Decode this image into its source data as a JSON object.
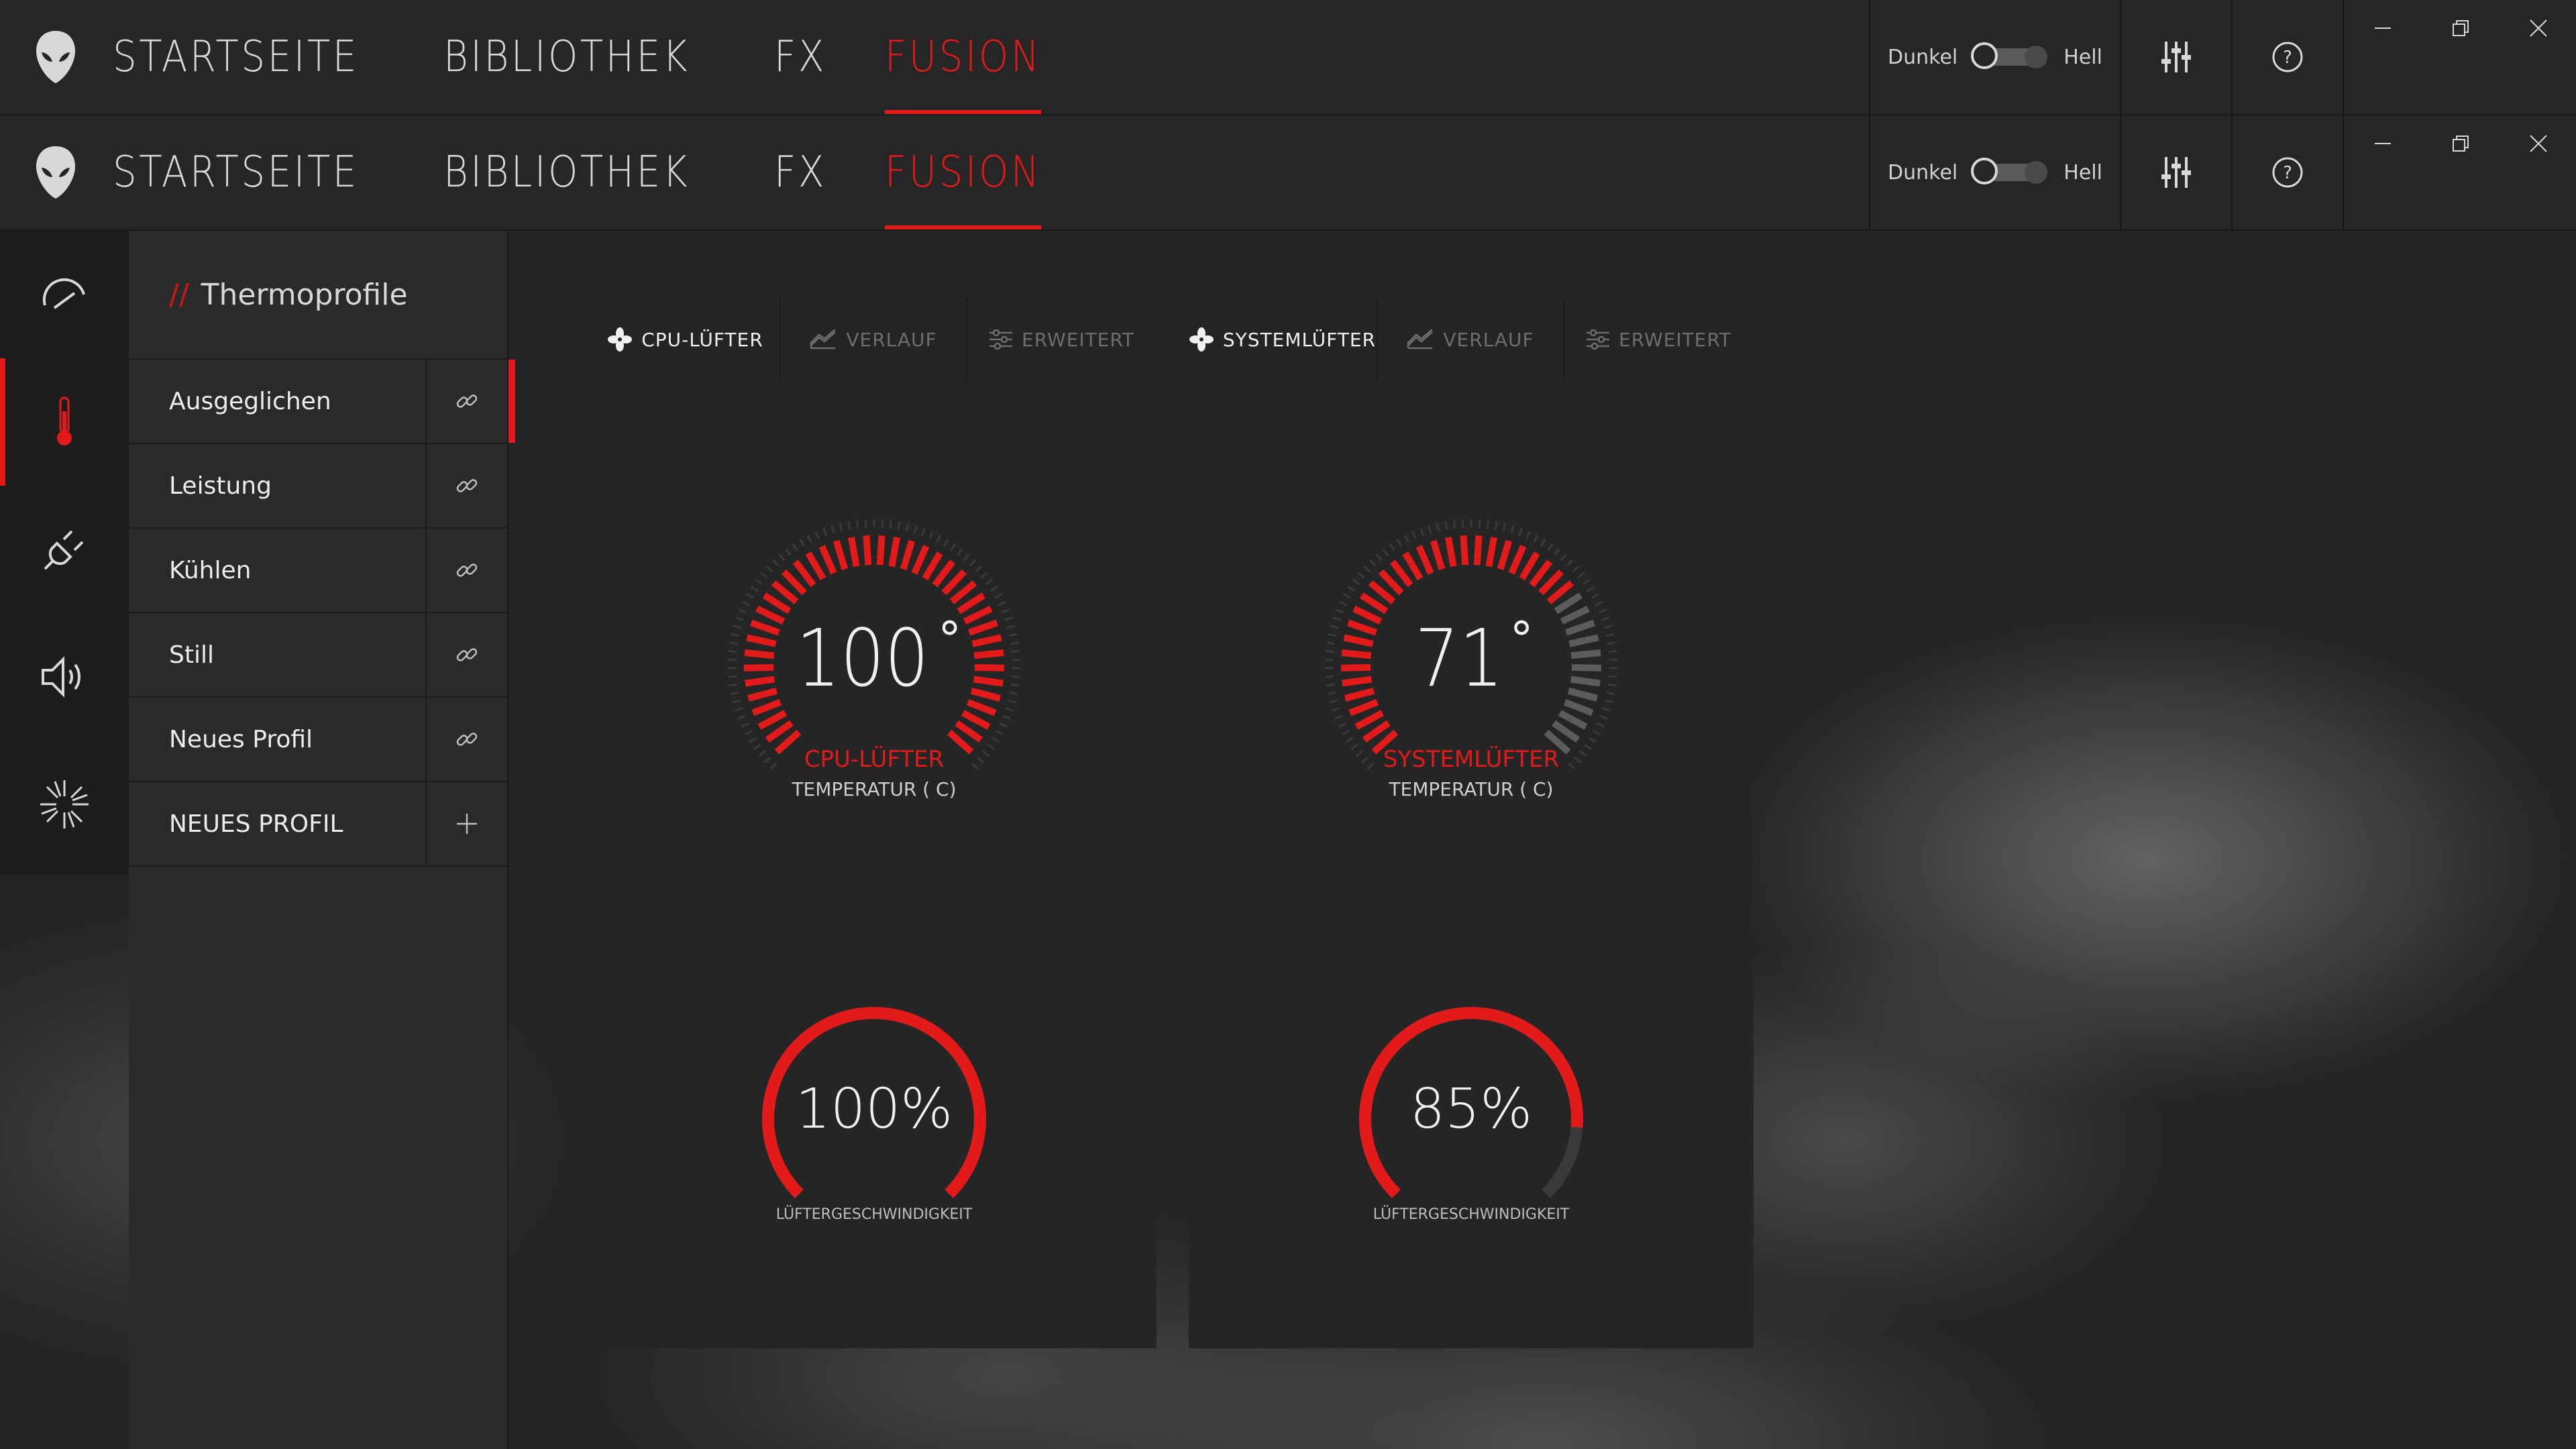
{
  "app": {
    "nav": [
      "STARTSEITE",
      "BIBLIOTHEK",
      "FX",
      "FUSION"
    ],
    "active_nav": 3,
    "theme": {
      "dark_label": "Dunkel",
      "light_label": "Hell"
    },
    "icons": [
      "alienware-logo-icon",
      "equalizer-icon",
      "help-icon",
      "minimize-icon",
      "restore-icon",
      "close-icon"
    ]
  },
  "rail": {
    "items": [
      "overclock-icon",
      "thermometer-icon",
      "power-plug-icon",
      "speaker-icon",
      "sunburst-icon"
    ],
    "active": 1
  },
  "profiles": {
    "title": "Thermoprofile",
    "items": [
      {
        "label": "Ausgeglichen",
        "action": "link-icon"
      },
      {
        "label": "Leistung",
        "action": "link-icon"
      },
      {
        "label": "Kühlen",
        "action": "link-icon"
      },
      {
        "label": "Still",
        "action": "link-icon"
      },
      {
        "label": "Neues Profil",
        "action": "link-icon"
      },
      {
        "label": "NEUES PROFIL",
        "action": "plus-icon"
      }
    ],
    "active": 0
  },
  "fans": [
    {
      "tabs": [
        "CPU-LÜFTER",
        "VERLAUF",
        "ERWEITERT"
      ],
      "temperature": 100,
      "temp_text": "100",
      "degree": "°",
      "name": "CPU-LÜFTER",
      "temp_label": "TEMPERATUR ( C)",
      "speed_percent": 100,
      "speed_text": "100%",
      "speed_label": "LÜFTERGESCHWINDIGKEIT"
    },
    {
      "tabs": [
        "SYSTEMLÜFTER",
        "VERLAUF",
        "ERWEITERT"
      ],
      "temperature": 71,
      "temp_text": "71",
      "degree": "°",
      "name": "SYSTEMLÜFTER",
      "temp_label": "TEMPERATUR ( C)",
      "speed_percent": 85,
      "speed_text": "85%",
      "speed_label": "LÜFTERGESCHWINDIGKEIT"
    }
  ],
  "colors": {
    "accent": "#e21a1a",
    "inactive_tick": "#5c5c5c"
  }
}
